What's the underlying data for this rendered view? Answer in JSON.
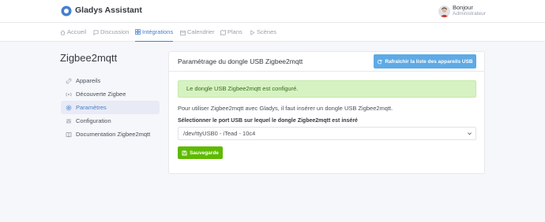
{
  "header": {
    "brand": "Gladys Assistant",
    "user_greeting": "Bonjour",
    "user_role": "Administrateur"
  },
  "nav": {
    "items": [
      {
        "label": "Accueil",
        "icon": "home-icon"
      },
      {
        "label": "Discussion",
        "icon": "message-square-icon"
      },
      {
        "label": "Intégrations",
        "icon": "grid-icon"
      },
      {
        "label": "Calendrier",
        "icon": "calendar-icon"
      },
      {
        "label": "Plans",
        "icon": "map-icon"
      },
      {
        "label": "Scènes",
        "icon": "play-icon"
      }
    ],
    "active": "Intégrations"
  },
  "sidebar": {
    "title": "Zigbee2mqtt",
    "items": [
      {
        "label": "Appareils",
        "icon": "link-icon"
      },
      {
        "label": "Découverte Zigbee",
        "icon": "radio-icon"
      },
      {
        "label": "Paramètres",
        "icon": "settings-icon"
      },
      {
        "label": "Configuration",
        "icon": "sliders-icon"
      },
      {
        "label": "Documentation Zigbee2mqtt",
        "icon": "book-icon"
      }
    ],
    "active": "Paramètres"
  },
  "card": {
    "title": "Paramétrage du dongle USB Zigbee2mqtt",
    "refresh_label": "Rafraîchir la liste des appareils USB",
    "alert_text": "Le dongle USB Zigbee2mqtt est configuré.",
    "description": "Pour utiliser Zigbee2mqtt avec Gladys, il faut insérer un dongle USB Zigbee2mqtt.",
    "select_label": "Sélectionner le port USB sur lequel le dongle Zigbee2mqtt est inséré",
    "select_value": "/dev/ttyUSB0 - iTead - 10c4",
    "save_label": "Sauvegarde"
  },
  "colors": {
    "primary": "#467fcf",
    "info": "#5eaae5",
    "success": "#5eba00",
    "alert_bg": "#d7f2c2"
  }
}
